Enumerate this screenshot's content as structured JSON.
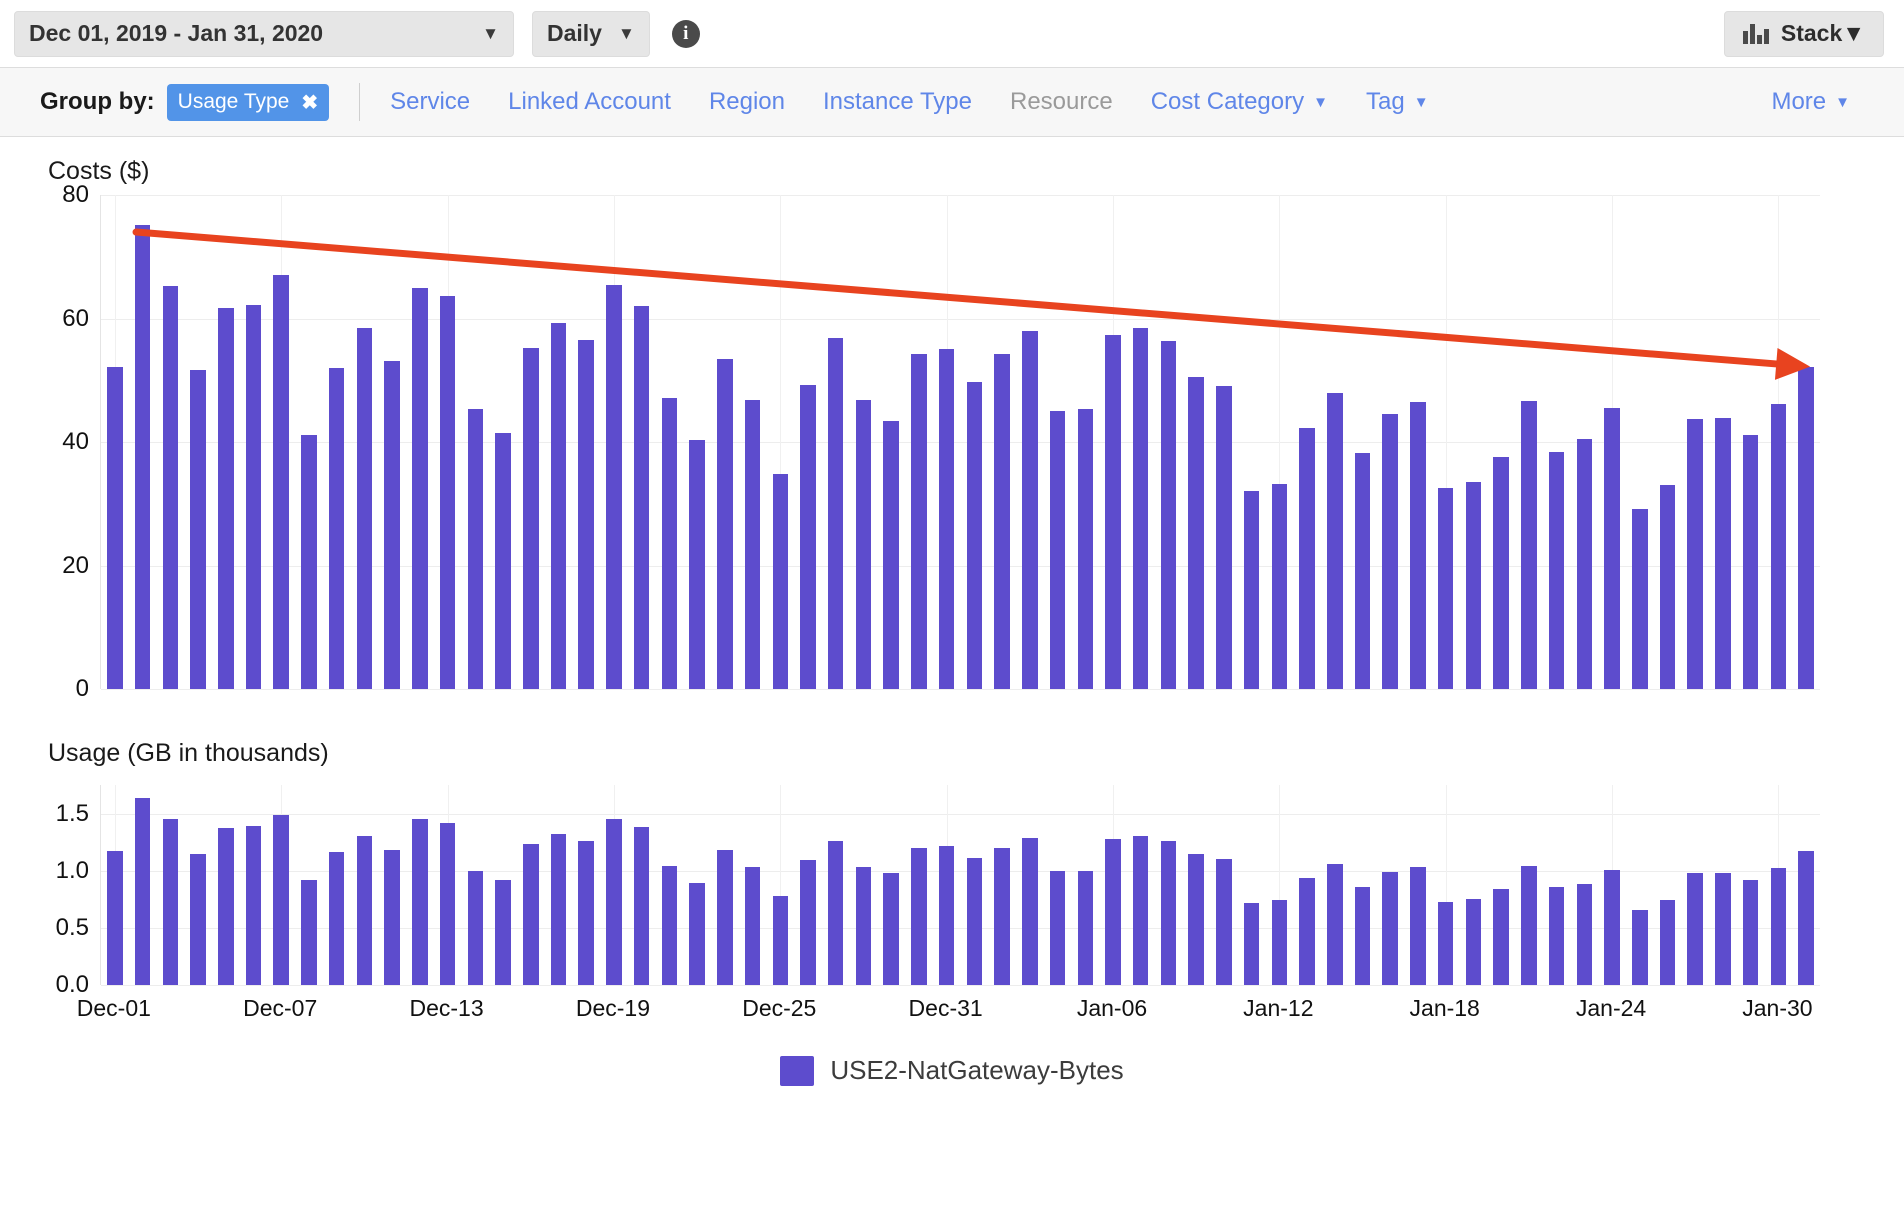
{
  "toolbar": {
    "date_range": "Dec 01, 2019 - Jan 31, 2020",
    "granularity": "Daily",
    "info_icon": "info-icon",
    "info_glyph": "i",
    "caret_glyph": "▼",
    "stack_label": "Stack",
    "stack_icon": "bar-chart-icon"
  },
  "group_by": {
    "label": "Group by:",
    "selected_chip": {
      "label": "Usage Type",
      "remove_glyph": "✖"
    },
    "items": [
      {
        "label": "Service",
        "disabled": false,
        "has_caret": false
      },
      {
        "label": "Linked Account",
        "disabled": false,
        "has_caret": false
      },
      {
        "label": "Region",
        "disabled": false,
        "has_caret": false
      },
      {
        "label": "Instance Type",
        "disabled": false,
        "has_caret": false
      },
      {
        "label": "Resource",
        "disabled": true,
        "has_caret": false
      },
      {
        "label": "Cost Category",
        "disabled": false,
        "has_caret": true
      },
      {
        "label": "Tag",
        "disabled": false,
        "has_caret": true
      }
    ],
    "more": {
      "label": "More",
      "has_caret": true
    }
  },
  "legend": {
    "series_name": "USE2-NatGateway-Bytes",
    "color": "#5d4ccd"
  },
  "annotation": {
    "type": "trend-arrow",
    "color": "#e8431f",
    "start_value": 74,
    "end_value": 52.2,
    "start_index": 1,
    "end_index": 61,
    "direction": "downward"
  },
  "chart_data": [
    {
      "type": "bar",
      "title": "Costs ($)",
      "ylabel": "Costs ($)",
      "xlabel": "",
      "ylim": [
        0,
        80
      ],
      "yticks": [
        0,
        20,
        40,
        60,
        80
      ],
      "ytick_labels": [
        "0",
        "20",
        "40",
        "60",
        "80"
      ],
      "grid": true,
      "legend_position": "bottom-center",
      "bar_color": "#5d4ccd",
      "categories": [
        "Dec-01",
        "Dec-02",
        "Dec-03",
        "Dec-04",
        "Dec-05",
        "Dec-06",
        "Dec-07",
        "Dec-08",
        "Dec-09",
        "Dec-10",
        "Dec-11",
        "Dec-12",
        "Dec-13",
        "Dec-14",
        "Dec-15",
        "Dec-16",
        "Dec-17",
        "Dec-18",
        "Dec-19",
        "Dec-20",
        "Dec-21",
        "Dec-22",
        "Dec-23",
        "Dec-24",
        "Dec-25",
        "Dec-26",
        "Dec-27",
        "Dec-28",
        "Dec-29",
        "Dec-30",
        "Dec-31",
        "Jan-01",
        "Jan-02",
        "Jan-03",
        "Jan-04",
        "Jan-05",
        "Jan-06",
        "Jan-07",
        "Jan-08",
        "Jan-09",
        "Jan-10",
        "Jan-11",
        "Jan-12",
        "Jan-13",
        "Jan-14",
        "Jan-15",
        "Jan-16",
        "Jan-17",
        "Jan-18",
        "Jan-19",
        "Jan-20",
        "Jan-21",
        "Jan-22",
        "Jan-23",
        "Jan-24",
        "Jan-25",
        "Jan-26",
        "Jan-27",
        "Jan-28",
        "Jan-29",
        "Jan-30",
        "Jan-31"
      ],
      "tick_labels": [
        "Dec-01",
        "Dec-07",
        "Dec-13",
        "Dec-19",
        "Dec-25",
        "Dec-31",
        "Jan-06",
        "Jan-12",
        "Jan-18",
        "Jan-24",
        "Jan-30"
      ],
      "tick_indices": [
        0,
        6,
        12,
        18,
        24,
        30,
        36,
        42,
        48,
        54,
        60
      ],
      "series": [
        {
          "name": "USE2-NatGateway-Bytes",
          "values": [
            52.1,
            75.2,
            65.3,
            51.6,
            61.7,
            62.2,
            67.1,
            41.2,
            52.0,
            58.5,
            53.2,
            65.0,
            63.6,
            45.3,
            41.4,
            55.3,
            59.3,
            56.5,
            65.4,
            62.1,
            47.2,
            40.4,
            53.4,
            46.8,
            34.8,
            49.2,
            56.9,
            46.8,
            43.4,
            54.2,
            55.0,
            49.7,
            54.2,
            58.0,
            45.0,
            45.3,
            57.4,
            58.4,
            56.4,
            50.6,
            49.0,
            32.0,
            33.2,
            42.2,
            48.0,
            38.3,
            44.6,
            46.4,
            32.6,
            33.6,
            37.6,
            46.7,
            38.4,
            40.5,
            45.5,
            29.2,
            33.0,
            43.8,
            43.9,
            41.2,
            46.1,
            52.2
          ]
        }
      ]
    },
    {
      "type": "bar",
      "title": "Usage (GB in thousands)",
      "ylabel": "Usage (GB in thousands)",
      "xlabel": "",
      "ylim": [
        0,
        1.75
      ],
      "yticks": [
        0.0,
        0.5,
        1.0,
        1.5
      ],
      "ytick_labels": [
        "0.0",
        "0.5",
        "1.0",
        "1.5"
      ],
      "grid": true,
      "bar_color": "#5d4ccd",
      "categories": [
        "Dec-01",
        "Dec-02",
        "Dec-03",
        "Dec-04",
        "Dec-05",
        "Dec-06",
        "Dec-07",
        "Dec-08",
        "Dec-09",
        "Dec-10",
        "Dec-11",
        "Dec-12",
        "Dec-13",
        "Dec-14",
        "Dec-15",
        "Dec-16",
        "Dec-17",
        "Dec-18",
        "Dec-19",
        "Dec-20",
        "Dec-21",
        "Dec-22",
        "Dec-23",
        "Dec-24",
        "Dec-25",
        "Dec-26",
        "Dec-27",
        "Dec-28",
        "Dec-29",
        "Dec-30",
        "Dec-31",
        "Jan-01",
        "Jan-02",
        "Jan-03",
        "Jan-04",
        "Jan-05",
        "Jan-06",
        "Jan-07",
        "Jan-08",
        "Jan-09",
        "Jan-10",
        "Jan-11",
        "Jan-12",
        "Jan-13",
        "Jan-14",
        "Jan-15",
        "Jan-16",
        "Jan-17",
        "Jan-18",
        "Jan-19",
        "Jan-20",
        "Jan-21",
        "Jan-22",
        "Jan-23",
        "Jan-24",
        "Jan-25",
        "Jan-26",
        "Jan-27",
        "Jan-28",
        "Jan-29",
        "Jan-30",
        "Jan-31"
      ],
      "tick_labels": [
        "Dec-01",
        "Dec-07",
        "Dec-13",
        "Dec-19",
        "Dec-25",
        "Dec-31",
        "Jan-06",
        "Jan-12",
        "Jan-18",
        "Jan-24",
        "Jan-30"
      ],
      "tick_indices": [
        0,
        6,
        12,
        18,
        24,
        30,
        36,
        42,
        48,
        54,
        60
      ],
      "series": [
        {
          "name": "USE2-NatGateway-Bytes",
          "values": [
            1.17,
            1.64,
            1.45,
            1.15,
            1.37,
            1.39,
            1.49,
            0.92,
            1.16,
            1.3,
            1.18,
            1.45,
            1.42,
            1.0,
            0.92,
            1.23,
            1.32,
            1.26,
            1.45,
            1.38,
            1.04,
            0.89,
            1.18,
            1.03,
            0.78,
            1.09,
            1.26,
            1.03,
            0.98,
            1.2,
            1.22,
            1.11,
            1.2,
            1.29,
            1.0,
            1.0,
            1.28,
            1.3,
            1.26,
            1.15,
            1.1,
            0.72,
            0.74,
            0.94,
            1.06,
            0.86,
            0.99,
            1.03,
            0.73,
            0.75,
            0.84,
            1.04,
            0.86,
            0.88,
            1.01,
            0.66,
            0.74,
            0.98,
            0.98,
            0.92,
            1.02,
            1.17
          ]
        }
      ]
    }
  ]
}
